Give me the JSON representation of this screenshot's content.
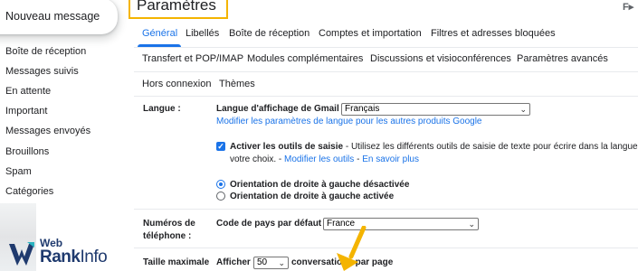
{
  "sidebar": {
    "compose_label": "Nouveau message",
    "items": [
      {
        "label": "Boîte de réception"
      },
      {
        "label": "Messages suivis"
      },
      {
        "label": "En attente"
      },
      {
        "label": "Important"
      },
      {
        "label": "Messages envoyés"
      },
      {
        "label": "Brouillons"
      },
      {
        "label": "Spam"
      },
      {
        "label": "Catégories"
      }
    ]
  },
  "watermark": {
    "line1": "Web",
    "line2": "Rank",
    "line3": "Info"
  },
  "header": {
    "title": "Paramètres",
    "right_icon": "keyboard-icon",
    "right_glyph": "F▸"
  },
  "tabs": [
    {
      "label": "Général",
      "active": true
    },
    {
      "label": "Libellés"
    },
    {
      "label": "Boîte de réception"
    },
    {
      "label": "Comptes et importation"
    },
    {
      "label": "Filtres et adresses bloquées"
    },
    {
      "label": "Transfert et POP/IMAP"
    },
    {
      "label": "Modules complémentaires"
    },
    {
      "label": "Discussions et visioconférences"
    },
    {
      "label": "Paramètres avancés"
    },
    {
      "label": "Hors connexion"
    },
    {
      "label": "Thèmes"
    }
  ],
  "settings": {
    "langue": {
      "label": "Langue :",
      "display_label": "Langue d'affichage de Gmail :",
      "display_value": "Français",
      "other_products_link": "Modifier les paramètres de langue pour les autres produits Google",
      "input_tools_checked": true,
      "input_tools_label": "Activer les outils de saisie",
      "input_tools_desc": " - Utilisez les différents outils de saisie de texte pour écrire dans la langue de",
      "input_tools_desc2": "votre choix. - ",
      "modify_tools_link": "Modifier les outils",
      "sep": " - ",
      "learn_more_link": "En savoir plus",
      "rtl_off_label": "Orientation de droite à gauche désactivée",
      "rtl_on_label": "Orientation de droite à gauche activée",
      "rtl_selected": "off"
    },
    "phone": {
      "label_line1": "Numéros de",
      "label_line2": "téléphone :",
      "country_label": "Code de pays par défaut :",
      "country_value": "France"
    },
    "page_size": {
      "label": "Taille maximale",
      "show_label": "Afficher",
      "show_value": "50",
      "suffix_label": "conversations par page"
    }
  },
  "colors": {
    "accent": "#1a73e8",
    "highlight": "#f4b400"
  }
}
